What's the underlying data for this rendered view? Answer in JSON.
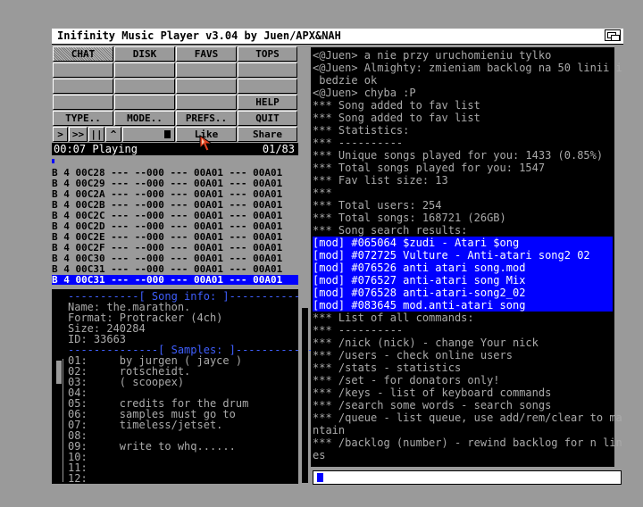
{
  "window": {
    "title": "Inifinity Music Player v3.04 by Juen/APX&NAH"
  },
  "menu": {
    "chat": "CHAT",
    "disk": "DISK",
    "favs": "FAVS",
    "tops": "TOPS",
    "help": "HELP",
    "type": "TYPE..",
    "mode": "MODE..",
    "prefs": "PREFS..",
    "quit": "QUIT",
    "like": "Like",
    "share": "Share"
  },
  "transport": {
    "play": ">",
    "next": ">>",
    "pause": "||",
    "up": "^"
  },
  "status": {
    "time": "00:07 Playing",
    "position": "01/83",
    "progress": 0.01
  },
  "playlist": {
    "rows": [
      "B 4 00C28 --- --000 --- 00A01 --- 00A01",
      "B 4 00C29 --- --000 --- 00A01 --- 00A01",
      "B 4 00C2A --- --000 --- 00A01 --- 00A01",
      "B 4 00C2B --- --000 --- 00A01 --- 00A01",
      "B 4 00C2C --- --000 --- 00A01 --- 00A01",
      "B 4 00C2D --- --000 --- 00A01 --- 00A01",
      "B 4 00C2E --- --000 --- 00A01 --- 00A01",
      "B 4 00C2F --- --000 --- 00A01 --- 00A01",
      "B 4 00C30 --- --000 --- 00A01 --- 00A01",
      "B 4 00C31 --- --000 --- 00A01 --- 00A01"
    ],
    "current": "B 4 00C31 --- --000 --- 00A01 --- 00A01"
  },
  "info": {
    "header": "-----------[ Song info: ]-----------",
    "name": "Name: the.marathon.",
    "format": "Format: Protracker (4ch)",
    "size": "Size: 240284",
    "id": "ID: 33663",
    "samples_header": "--------------[ Samples: ]-------------",
    "samples": [
      "01:     by jurgen ( jayce )",
      "02:     rotscheidt.",
      "03:     ( scoopex)",
      "04:",
      "05:     credits for the drum",
      "06:     samples must go to",
      "07:     timeless/jetset.",
      "08:",
      "09:     write to whq......",
      "10:",
      "11:",
      "12:"
    ]
  },
  "chat": {
    "lines": [
      "<@Juen> a nie przy uruchomieniu tylko",
      "<@Juen> Almighty: zmieniam backlog na 50 linii i",
      " bedzie ok",
      "<@Juen> chyba :P",
      "*** Song added to fav list",
      "*** Song added to fav list",
      "*** Statistics:",
      "*** ----------",
      "*** Unique songs played for you: 1433 (0.85%)",
      "*** Total songs played for you: 1547",
      "*** Fav list size: 13",
      "***",
      "*** Total users: 254",
      "*** Total songs: 168721 (26GB)",
      "*** Song search results:",
      "[mod] #065064 $zudi - Atari $ong",
      "[mod] #072725 Vulture - Anti-atari song2 02",
      "[mod] #076526 anti atari song.mod",
      "[mod] #076527 anti-atari song Mix",
      "[mod] #076528 anti-atari-song2_02",
      "[mod] #083645 mod.anti-atari song",
      "*** List of all commands:",
      "*** ----------",
      "*** /nick (nick) - change Your nick",
      "*** /users - check online users",
      "*** /stats - statistics",
      "*** /set - for donators only!",
      "*** /keys - list of keyboard commands",
      "*** /search some words - search songs",
      "*** /queue - list queue, use add/rem/clear to ma",
      "ntain",
      "*** /backlog (number) - rewind backlog for n lin",
      "es"
    ],
    "input_value": ""
  },
  "colors": {
    "highlight": "#0000ff",
    "panel": "#000000",
    "chrome": "#9a9a9a",
    "text_dim": "#aaaaaa",
    "text_blue": "#3f5fff"
  }
}
